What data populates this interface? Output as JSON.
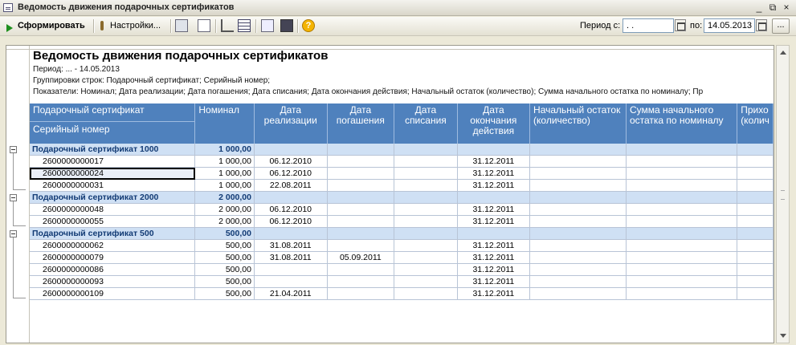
{
  "window": {
    "title": "Ведомость движения подарочных сертификатов",
    "controls": [
      "_",
      "⧉",
      "×"
    ]
  },
  "toolbar": {
    "generate_label": "Сформировать",
    "settings_label": "Настройки...",
    "period_from_label": "Период с:",
    "period_from_value": " .  .",
    "period_to_label": "по:",
    "period_to_value": "14.05.2013",
    "more_label": "...",
    "help_label": "?"
  },
  "report": {
    "title": "Ведомость движения подарочных сертификатов",
    "period_line": "Период: ... - 14.05.2013",
    "grouping_line": "Группировки строк: Подарочный сертификат; Серийный номер;",
    "indicators_line": "Показатели: Номинал; Дата реализации; Дата погашения; Дата списания; Дата окончания действия; Начальный остаток (количество); Сумма начального остатка по номиналу; Пр",
    "headers": {
      "cert": "Подарочный сертификат",
      "serial": "Серийный номер",
      "nominal": "Номинал",
      "sale_date": "Дата реализации",
      "redeem_date": "Дата погашения",
      "writeoff_date": "Дата списания",
      "end_date": "Дата окончания действия",
      "start_qty": "Начальный остаток (количество)",
      "start_sum": "Сумма начального остатка по номиналу",
      "income": "Прихо (колич"
    },
    "groups": [
      {
        "name": "Подарочный сертификат 1000",
        "nominal": "1 000,00",
        "rows": [
          {
            "serial": "2600000000017",
            "nominal": "1 000,00",
            "sale": "06.12.2010",
            "redeem": "",
            "writeoff": "",
            "end": "31.12.2011"
          },
          {
            "serial": "2600000000024",
            "nominal": "1 000,00",
            "sale": "06.12.2010",
            "redeem": "",
            "writeoff": "",
            "end": "31.12.2011"
          },
          {
            "serial": "2600000000031",
            "nominal": "1 000,00",
            "sale": "22.08.2011",
            "redeem": "",
            "writeoff": "",
            "end": "31.12.2011"
          }
        ]
      },
      {
        "name": "Подарочный сертификат 2000",
        "nominal": "2 000,00",
        "rows": [
          {
            "serial": "2600000000048",
            "nominal": "2 000,00",
            "sale": "06.12.2010",
            "redeem": "",
            "writeoff": "",
            "end": "31.12.2011"
          },
          {
            "serial": "2600000000055",
            "nominal": "2 000,00",
            "sale": "06.12.2010",
            "redeem": "",
            "writeoff": "",
            "end": "31.12.2011"
          }
        ]
      },
      {
        "name": "Подарочный сертификат 500",
        "nominal": "500,00",
        "rows": [
          {
            "serial": "2600000000062",
            "nominal": "500,00",
            "sale": "31.08.2011",
            "redeem": "",
            "writeoff": "",
            "end": "31.12.2011"
          },
          {
            "serial": "2600000000079",
            "nominal": "500,00",
            "sale": "31.08.2011",
            "redeem": "05.09.2011",
            "writeoff": "",
            "end": "31.12.2011"
          },
          {
            "serial": "2600000000086",
            "nominal": "500,00",
            "sale": "",
            "redeem": "",
            "writeoff": "",
            "end": "31.12.2011"
          },
          {
            "serial": "2600000000093",
            "nominal": "500,00",
            "sale": "",
            "redeem": "",
            "writeoff": "",
            "end": "31.12.2011"
          },
          {
            "serial": "2600000000109",
            "nominal": "500,00",
            "sale": "21.04.2011",
            "redeem": "",
            "writeoff": "",
            "end": "31.12.2011"
          }
        ]
      }
    ],
    "selected_serial": "2600000000024"
  },
  "colors": {
    "header_bg": "#4f81bd",
    "group_bg": "#cfe0f4",
    "group_text": "#113a74"
  }
}
